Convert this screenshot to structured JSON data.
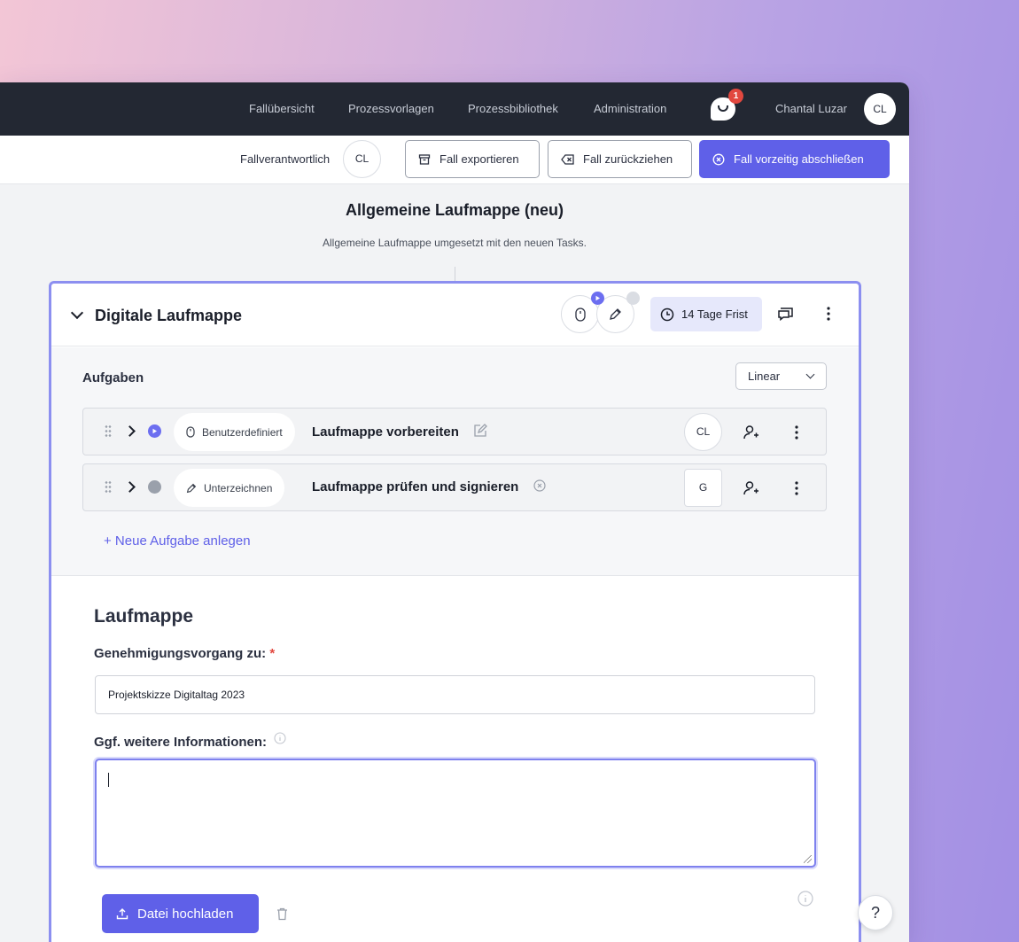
{
  "nav": {
    "links": [
      "Fallübersicht",
      "Prozessvorlagen",
      "Prozessbibliothek",
      "Administration"
    ],
    "notification_count": "1",
    "user_name": "Chantal Luzar",
    "user_initials": "CL"
  },
  "actions": {
    "owner_label": "Fallverantwortlich",
    "owner_initials": "CL",
    "export_label": "Fall exportieren",
    "withdraw_label": "Fall zurückziehen",
    "close_label": "Fall vorzeitig abschließen"
  },
  "process": {
    "title": "Allgemeine Laufmappe (neu)",
    "description": "Allgemeine Laufmappe umgesetzt mit den neuen Tasks."
  },
  "card": {
    "title": "Digitale Laufmappe",
    "deadline": "14 Tage Frist",
    "tasks_label": "Aufgaben",
    "mode": "Linear",
    "tasks": [
      {
        "type": "Benutzerdefiniert",
        "name": "Laufmappe vorbereiten",
        "assignee": "CL",
        "status": "active"
      },
      {
        "type": "Unterzeichnen",
        "name": "Laufmappe prüfen und signieren",
        "assignee": "G",
        "status": "pending"
      }
    ],
    "add_task_label": "+  Neue Aufgabe anlegen"
  },
  "form": {
    "title": "Laufmappe",
    "field1_label": "Genehmigungsvorgang zu:",
    "field1_required": "*",
    "field1_value": "Projektskizze Digitaltag 2023",
    "field2_label": "Ggf. weitere Informationen:",
    "field2_value": "",
    "upload_label": "Datei hochladen"
  },
  "help_label": "?",
  "colors": {
    "accent": "#5f60e8",
    "nav_bg": "#232833",
    "badge": "#e2483f"
  }
}
